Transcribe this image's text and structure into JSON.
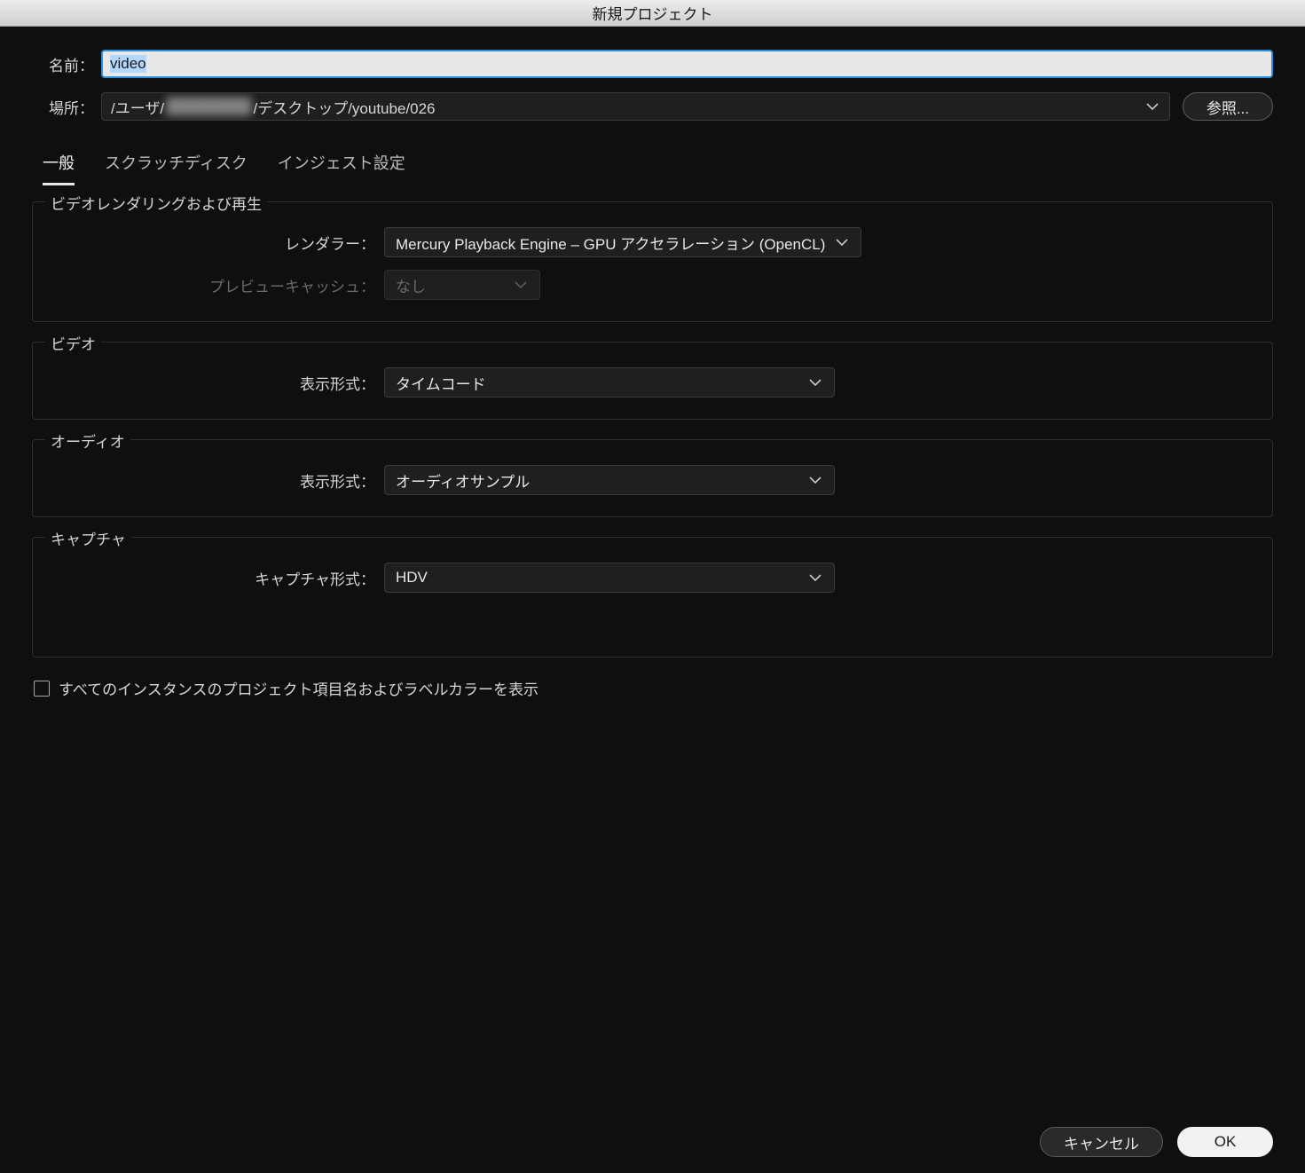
{
  "title": "新規プロジェクト",
  "labels": {
    "name": "名前：",
    "location": "場所：",
    "browse": "参照...",
    "renderer": "レンダラー：",
    "preview_cache": "プレビューキャッシュ：",
    "display_format": "表示形式：",
    "capture_format": "キャプチャ形式："
  },
  "values": {
    "name": "video",
    "location_pre": "/ユーザ/",
    "location_blur": "████████",
    "location_post": "/デスクトップ/youtube/026",
    "renderer": "Mercury Playback Engine – GPU アクセラレーション (OpenCL)",
    "preview_cache": "なし",
    "video_display": "タイムコード",
    "audio_display": "オーディオサンプル",
    "capture_format": "HDV"
  },
  "tabs": {
    "general": "一般",
    "scratch": "スクラッチディスク",
    "ingest": "インジェスト設定"
  },
  "groups": {
    "rendering": "ビデオレンダリングおよび再生",
    "video": "ビデオ",
    "audio": "オーディオ",
    "capture": "キャプチャ"
  },
  "checkbox": "すべてのインスタンスのプロジェクト項目名およびラベルカラーを表示",
  "buttons": {
    "cancel": "キャンセル",
    "ok": "OK"
  }
}
